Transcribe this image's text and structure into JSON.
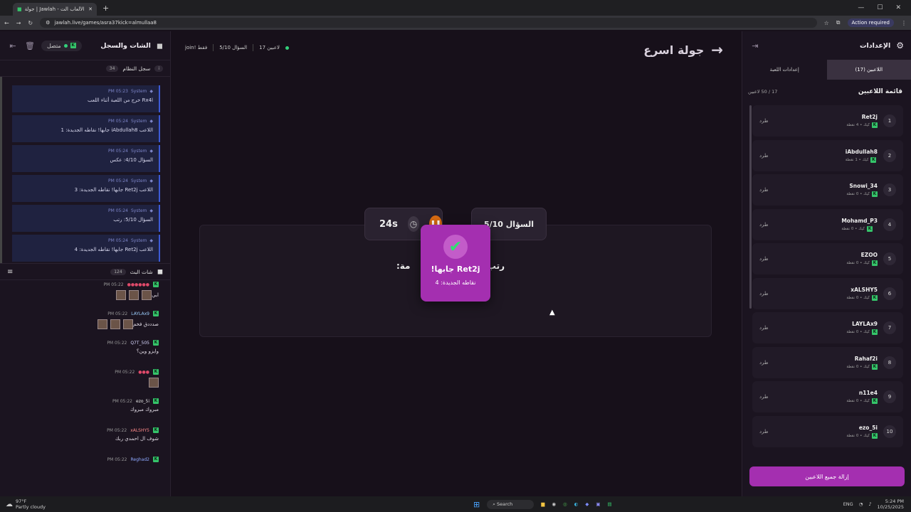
{
  "browser": {
    "tab_title": "جولة | Jawlah - منصة الألعاب الت...",
    "url": "jawlah.live/games/asra37kick=almullaa8",
    "action_required": "Action required"
  },
  "chat_panel": {
    "title": "الشات والسجل",
    "status": "متصل",
    "system_log_label": "سجل النظام",
    "system_log_count": "34",
    "system_messages": [
      {
        "sender": "System",
        "time": "05:23 PM",
        "text": "Rx4l خرج من اللعبة أثناء اللعب"
      },
      {
        "sender": "System",
        "time": "05:24 PM",
        "text": "اللاعب iAbdullah8 جابها! نقاطه الجديدة: 1"
      },
      {
        "sender": "System",
        "time": "05:24 PM",
        "text": "السؤال 4/10: عكس"
      },
      {
        "sender": "System",
        "time": "05:24 PM",
        "text": "اللاعب Ret2j جابها! نقاطه الجديدة: 3"
      },
      {
        "sender": "System",
        "time": "05:24 PM",
        "text": "السؤال 5/10: رتب"
      },
      {
        "sender": "System",
        "time": "05:24 PM",
        "text": "اللاعب Ret2j جابها! نقاطه الجديدة: 4"
      }
    ],
    "live_chat_label": "شات البث",
    "live_chat_count": "124",
    "chat_messages": [
      {
        "name": "",
        "time": "05:22 PM",
        "text": "ابي",
        "emotes": 3
      },
      {
        "name": "LAYLAx9",
        "time": "05:22 PM",
        "text": "صدددق فخم",
        "emotes": 3
      },
      {
        "name": "Q7T_505",
        "time": "05:22 PM",
        "text": "وايزو وين؟",
        "emotes": 0
      },
      {
        "name": "",
        "time": "05:22 PM",
        "text": "",
        "emotes": 1
      },
      {
        "name": "ezo_5i",
        "time": "05:22 PM",
        "text": "مبروك مبروك",
        "emotes": 0
      },
      {
        "name": "xALSHY5",
        "time": "05:22 PM",
        "text": "شوف ال احمدي ربك",
        "emotes": 0
      },
      {
        "name": "Reghad2",
        "time": "05:22 PM",
        "text": "",
        "emotes": 0
      }
    ]
  },
  "game": {
    "title": "جولة اسرع",
    "players_online": "17 لاعبين",
    "question_progress": "السؤال 5/10",
    "join_status": "join! فقط",
    "question_badge": "السؤال 5/10",
    "timer": "24s",
    "question_text": "رتب",
    "question_suffix": "مة:",
    "popup_title": "Ret2j جابها!",
    "popup_sub": "نقاطه الجديدة: 4"
  },
  "settings_panel": {
    "title": "الإعدادات",
    "tabs": [
      "اللاعبين (17)",
      "إعدادات اللعبة"
    ],
    "list_title": "قائمة اللاعبين",
    "list_count": "17 / 50 لاعبين",
    "kick_label": "طرد",
    "remove_all": "إزالة جميع اللاعبين",
    "players": [
      {
        "rank": "1",
        "name": "Ret2j",
        "meta": "كيك • 4 نقطة"
      },
      {
        "rank": "2",
        "name": "iAbdullah8",
        "meta": "كيك • 1 نقطة"
      },
      {
        "rank": "3",
        "name": "Snowi_34",
        "meta": "كيك • 0 نقطة"
      },
      {
        "rank": "4",
        "name": "Mohamd_P3",
        "meta": "كيك • 0 نقطة"
      },
      {
        "rank": "5",
        "name": "EZOO",
        "meta": "كيك • 0 نقطة"
      },
      {
        "rank": "6",
        "name": "xALSHY5",
        "meta": "كيك • 0 نقطة"
      },
      {
        "rank": "7",
        "name": "LAYLAx9",
        "meta": "كيك • 0 نقطة"
      },
      {
        "rank": "8",
        "name": "Rahaf2i",
        "meta": "كيك • 0 نقطة"
      },
      {
        "rank": "9",
        "name": "n11e4",
        "meta": "كيك • 0 نقطة"
      },
      {
        "rank": "10",
        "name": "ezo_5i",
        "meta": "كيك • 0 نقطة"
      }
    ]
  },
  "taskbar": {
    "weather_temp": "97°F",
    "weather_desc": "Partly cloudy",
    "search": "Search",
    "lang": "ENG",
    "time": "5:24 PM",
    "date": "10/25/2025"
  }
}
